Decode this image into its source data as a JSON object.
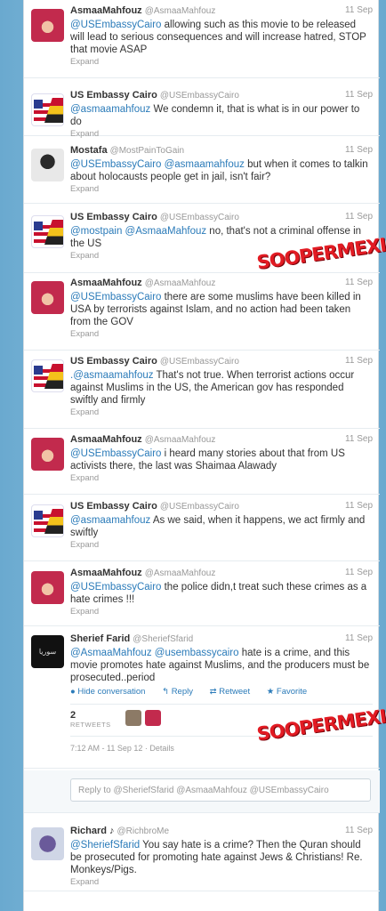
{
  "tweets": [
    {
      "name": "AsmaaMahfouz",
      "handle": "@AsmaaMahfouz",
      "time": "11 Sep",
      "mention": "@USEmbassyCairo",
      "text": " allowing such as this movie to be released will lead to serious consequences and will increase hatred, STOP that movie ASAP",
      "expand": "Expand"
    },
    {
      "name": "US Embassy Cairo",
      "handle": "@USEmbassyCairo",
      "time": "11 Sep",
      "mention": "@asmaamahfouz",
      "text": " We condemn it, that is what is in our power to do",
      "expand": "Expand"
    },
    {
      "name": "Mostafa",
      "handle": "@MostPainToGain",
      "time": "11 Sep",
      "mention": "@USEmbassyCairo @asmaamahfouz",
      "text": " but when it comes to talkin about holocausts people get in jail, isn't fair?",
      "expand": "Expand"
    },
    {
      "name": "US Embassy Cairo",
      "handle": "@USEmbassyCairo",
      "time": "11 Sep",
      "mention": "@mostpain @AsmaaMahfouz",
      "text": " no, that's not a criminal offense in the US",
      "expand": "Expand"
    },
    {
      "name": "AsmaaMahfouz",
      "handle": "@AsmaaMahfouz",
      "time": "11 Sep",
      "mention": "@USEmbassyCairo",
      "text": " there are some muslims have been killed in USA by terrorists against Islam, and no action had been taken from the GOV",
      "expand": "Expand"
    },
    {
      "name": "US Embassy Cairo",
      "handle": "@USEmbassyCairo",
      "time": "11 Sep",
      "mention": ".@asmaamahfouz",
      "text": " That's not true. When terrorist actions occur against Muslims in the US, the American gov has responded swiftly and firmly",
      "expand": "Expand"
    },
    {
      "name": "AsmaaMahfouz",
      "handle": "@AsmaaMahfouz",
      "time": "11 Sep",
      "mention": "@USEmbassyCairo",
      "text": " i heard many stories about that from US activists there, the last was Shaimaa Alawady",
      "expand": "Expand"
    },
    {
      "name": "US Embassy Cairo",
      "handle": "@USEmbassyCairo",
      "time": "11 Sep",
      "mention": "@asmaamahfouz",
      "text": " As we said, when it happens, we act firmly and swiftly",
      "expand": "Expand"
    },
    {
      "name": "AsmaaMahfouz",
      "handle": "@AsmaaMahfouz",
      "time": "11 Sep",
      "mention": "@USEmbassyCairo",
      "text": " the police didn,t treat such these crimes as a hate crimes !!!",
      "expand": "Expand"
    }
  ],
  "focused": {
    "name": "Sherief Farid",
    "handle": "@SheriefSfarid",
    "time": "11 Sep",
    "mention": "@AsmaaMahfouz @usembassycairo",
    "text": " hate is a crime, and this movie promotes hate against Muslims, and the producers must be prosecuted..period",
    "hide": "Hide conversation",
    "reply": "Reply",
    "retweet": "Retweet",
    "favorite": "Favorite",
    "retweets_count": "2",
    "retweets_label": "RETWEETS",
    "timestamp": "7:12 AM - 11 Sep 12 · Details",
    "avatar_text": "سوريا"
  },
  "reply_box": {
    "placeholder": "Reply to @SheriefSfarid @AsmaaMahfouz @USEmbassyCairo"
  },
  "last": {
    "name": "Richard ♪",
    "handle": "@RichbroMe",
    "time": "11 Sep",
    "mention": "@SheriefSfarid",
    "text": " You say hate is a crime? Then the Quran should be prosecuted for promoting hate against Jews & Christians! Re. Monkeys/Pigs.",
    "expand": "Expand"
  },
  "watermark": "SOOPERMEXICAN",
  "colors": {
    "link": "#2b7bb9",
    "watermark": "#e21b23"
  }
}
